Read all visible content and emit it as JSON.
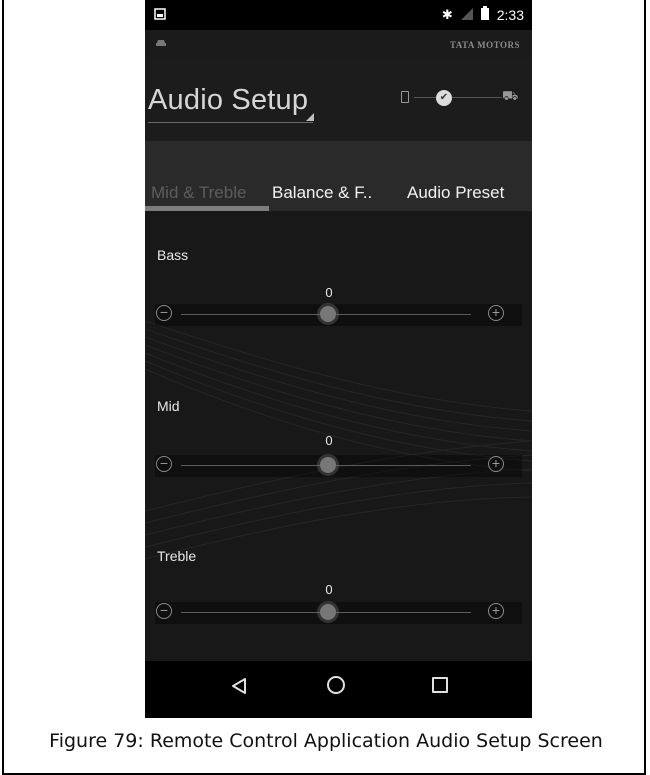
{
  "status_bar": {
    "time": "2:33",
    "left_icon": "image-notification-icon",
    "icons": [
      "bluetooth-icon",
      "signal-icon",
      "battery-icon"
    ]
  },
  "brand_bar": {
    "left_icon": "car-logo-icon",
    "brand": "TATA MOTORS"
  },
  "header": {
    "title": "Audio Setup",
    "mode_switch": {
      "left_icon": "phone-icon",
      "right_icon": "car-icon",
      "state_icon": "check-icon"
    }
  },
  "tabs": [
    {
      "label": "Mid & Treble",
      "active": false
    },
    {
      "label": "Balance & F..",
      "active": true
    },
    {
      "label": "Audio Preset",
      "active": true
    }
  ],
  "equalizer": [
    {
      "label": "Bass",
      "value": "0",
      "level": 0
    },
    {
      "label": "Mid",
      "value": "0",
      "level": 0
    },
    {
      "label": "Treble",
      "value": "0",
      "level": 0
    }
  ],
  "nav_bar": {
    "icons": [
      "back-icon",
      "home-icon",
      "recents-icon"
    ]
  },
  "caption": "Figure 79: Remote Control Application Audio Setup Screen",
  "colors": {
    "background": "#181818",
    "text": "#e8e8e8",
    "tab_indicator": "#7d7d7d"
  }
}
